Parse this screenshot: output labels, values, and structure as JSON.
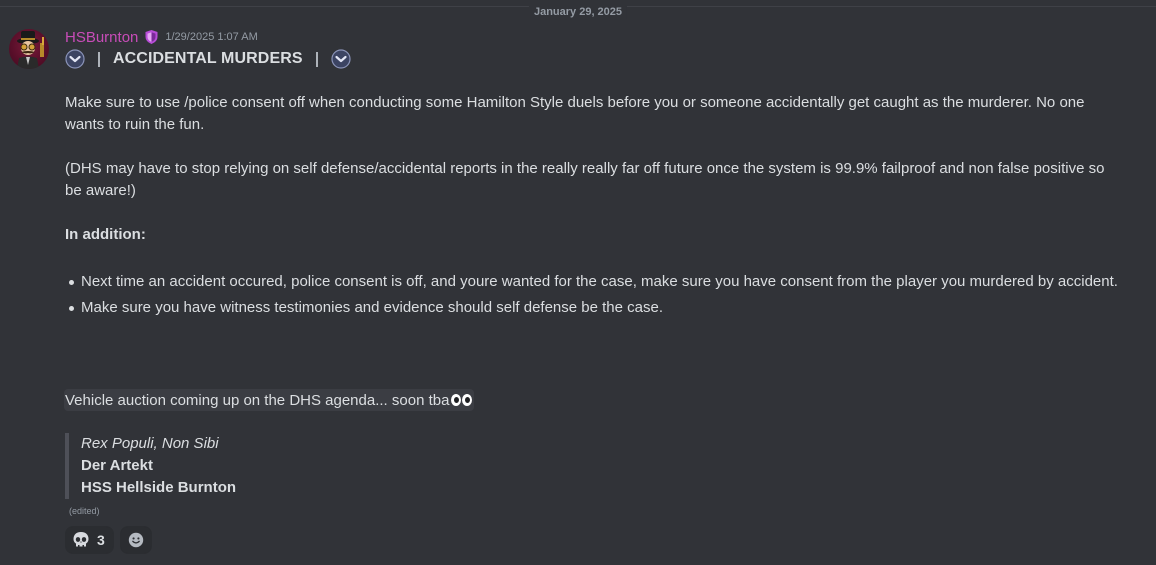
{
  "divider": {
    "date": "January 29, 2025"
  },
  "message": {
    "author": "HSBurnton",
    "author_color": "#c84cb8",
    "role_icon": "shield-icon",
    "timestamp": "1/29/2025 1:07 AM",
    "title": "ACCIDENTAL MURDERS",
    "paragraph1": "Make sure to use /police consent off when conducting some Hamilton Style duels before you or someone accidentally get caught as the murderer. No one wants to ruin the fun.",
    "paragraph2": "(DHS may have to stop relying on self defense/accidental reports in the really really far off future once the system is 99.9% failproof and non false positive so be aware!)",
    "in_addition": "In addition:",
    "bullets": [
      "Next time an accident occured, police consent is off, and youre wanted for the case, make sure you have consent from the player you murdered by accident.",
      "Make sure you have witness testimonies and evidence should self defense be the case."
    ],
    "highlight": "Vehicle auction coming up on the DHS agenda... soon tba",
    "highlight_emoji": "eyes-icon",
    "quote": {
      "line1": "Rex Populi, Non Sibi",
      "line2": "Der Artekt",
      "line3": "HSS Hellside Burnton"
    },
    "edited": "(edited)",
    "reactions": [
      {
        "emoji": "skull-icon",
        "count": "3"
      }
    ],
    "add_reaction_icon": "add-reaction-icon"
  }
}
